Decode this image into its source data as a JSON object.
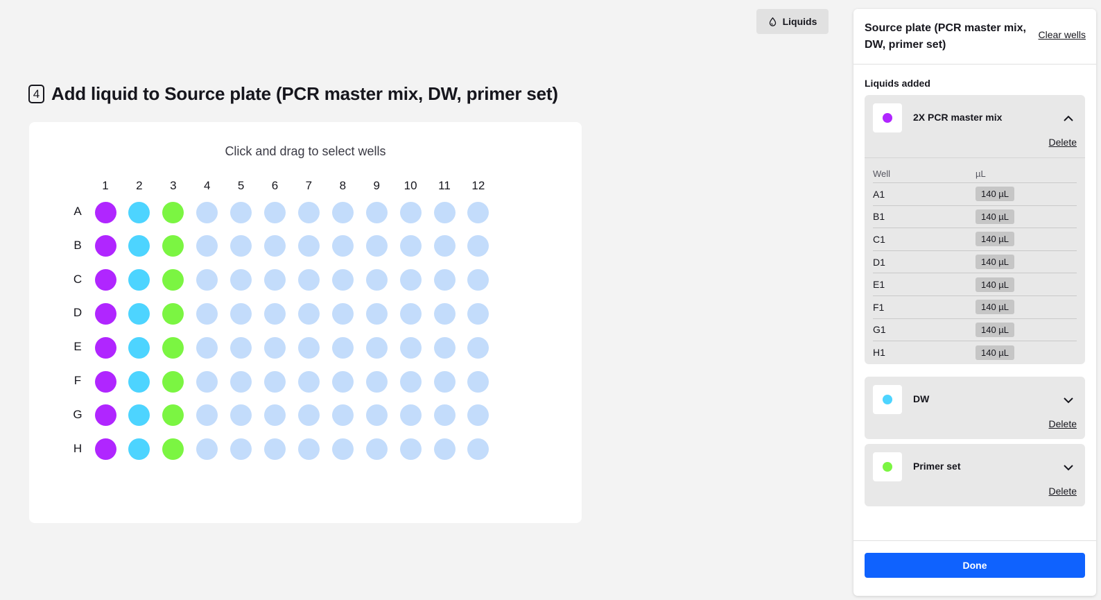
{
  "toolbar": {
    "liquids_label": "Liquids",
    "liquids_icon": "droplet-icon"
  },
  "step": {
    "number": "4",
    "title": "Add liquid to Source plate (PCR master mix, DW, primer set)"
  },
  "plate": {
    "hint": "Click and drag to select wells",
    "columns": [
      "1",
      "2",
      "3",
      "4",
      "5",
      "6",
      "7",
      "8",
      "9",
      "10",
      "11",
      "12"
    ],
    "rows": [
      "A",
      "B",
      "C",
      "D",
      "E",
      "F",
      "G",
      "H"
    ],
    "empty_color": "#c3dcfb",
    "filled_columns": [
      {
        "column": "1",
        "color": "#b026ff"
      },
      {
        "column": "2",
        "color": "#4dd4ff"
      },
      {
        "column": "3",
        "color": "#7bf542"
      }
    ]
  },
  "panel": {
    "title": "Source plate (PCR master mix, DW, primer set)",
    "clear_wells": "Clear wells",
    "liquids_added_label": "Liquids added",
    "liquids": [
      {
        "name": "2X PCR master mix",
        "color": "#b026ff",
        "expanded": true,
        "delete_label": "Delete",
        "table_headers": [
          "Well",
          "µL"
        ],
        "wells": [
          {
            "well": "A1",
            "volume": "140 µL"
          },
          {
            "well": "B1",
            "volume": "140 µL"
          },
          {
            "well": "C1",
            "volume": "140 µL"
          },
          {
            "well": "D1",
            "volume": "140 µL"
          },
          {
            "well": "E1",
            "volume": "140 µL"
          },
          {
            "well": "F1",
            "volume": "140 µL"
          },
          {
            "well": "G1",
            "volume": "140 µL"
          },
          {
            "well": "H1",
            "volume": "140 µL"
          }
        ]
      },
      {
        "name": "DW",
        "color": "#4dd4ff",
        "expanded": false,
        "delete_label": "Delete"
      },
      {
        "name": "Primer set",
        "color": "#7bf542",
        "expanded": false,
        "delete_label": "Delete"
      }
    ],
    "done_label": "Done"
  }
}
